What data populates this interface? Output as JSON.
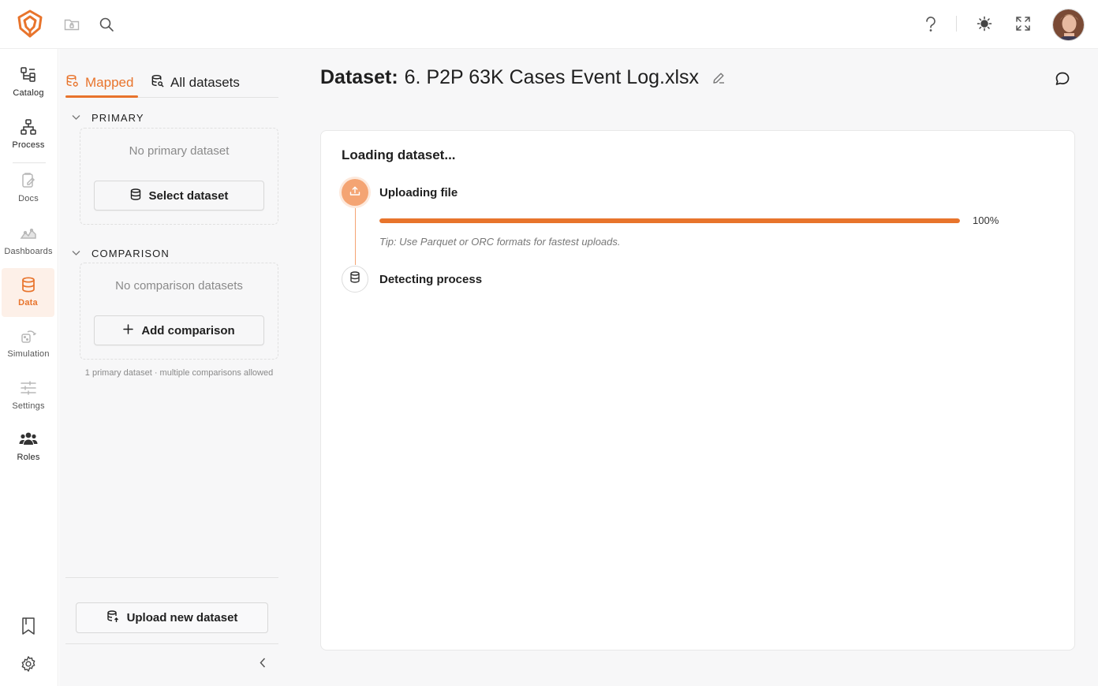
{
  "rail": {
    "items": [
      {
        "label": "Catalog"
      },
      {
        "label": "Process"
      },
      {
        "label": "Docs"
      },
      {
        "label": "Dashboards"
      },
      {
        "label": "Data"
      },
      {
        "label": "Simulation"
      },
      {
        "label": "Settings"
      },
      {
        "label": "Roles"
      }
    ],
    "active": "Data"
  },
  "panel": {
    "tabs": [
      {
        "label": "Mapped"
      },
      {
        "label": "All datasets"
      }
    ],
    "primary": {
      "heading": "PRIMARY",
      "empty": "No primary dataset",
      "button": "Select dataset"
    },
    "comparison": {
      "heading": "COMPARISON",
      "empty": "No comparison datasets",
      "button": "Add comparison"
    },
    "hint": "1 primary dataset · multiple comparisons allowed",
    "upload_button": "Upload new dataset"
  },
  "main": {
    "title_label": "Dataset:",
    "title_value": "6. P2P 63K Cases Event Log.xlsx",
    "card_title": "Loading dataset...",
    "steps": [
      {
        "title": "Uploading file",
        "progress_percent": 100,
        "progress_label": "100%",
        "tip": "Tip: Use Parquet or ORC formats for fastest uploads."
      },
      {
        "title": "Detecting process"
      }
    ]
  },
  "colors": {
    "accent": "#e8742c",
    "accent_soft": "#f4a473",
    "active_bg": "#fdf0e8"
  }
}
